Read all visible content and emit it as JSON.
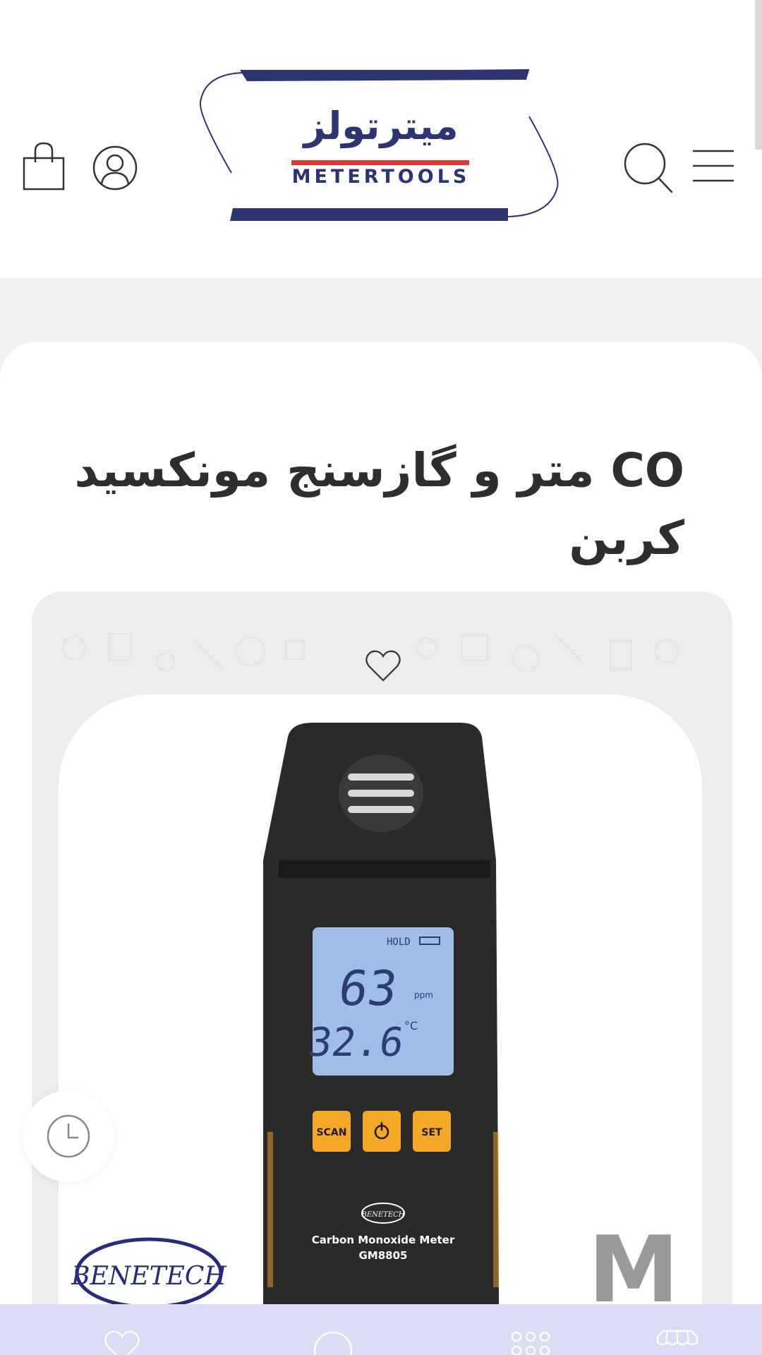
{
  "header": {
    "logo_fa": "میترتولز",
    "logo_en": "METERTOOLS",
    "icons": {
      "menu": "hamburger-icon",
      "search": "search-icon",
      "account": "user-icon",
      "cart": "shopping-bag-icon"
    }
  },
  "product": {
    "title": "CO متر و گازسنج مونکسید کربن",
    "image": {
      "device_display_reading": "63",
      "device_display_unit": "ppm",
      "device_display_temp": "32.6",
      "device_display_temp_unit": "°C",
      "device_hold_label": "HOLD",
      "device_buttons": [
        "SCAN",
        "SET"
      ],
      "device_brand": "BENETECH",
      "device_name": "Carbon Monoxide Meter",
      "device_model": "GM8805",
      "watermark_brand": "BENETECH",
      "watermark_letter": "M"
    }
  },
  "bottom_nav": {
    "items": [
      "heart-icon",
      "search-icon",
      "grid-icon",
      "store-icon"
    ]
  },
  "colors": {
    "brand_navy": "#2c3572",
    "brand_red": "#d83a3a",
    "nav_background": "#dcdcf6",
    "device_buttons": "#f4a825"
  }
}
